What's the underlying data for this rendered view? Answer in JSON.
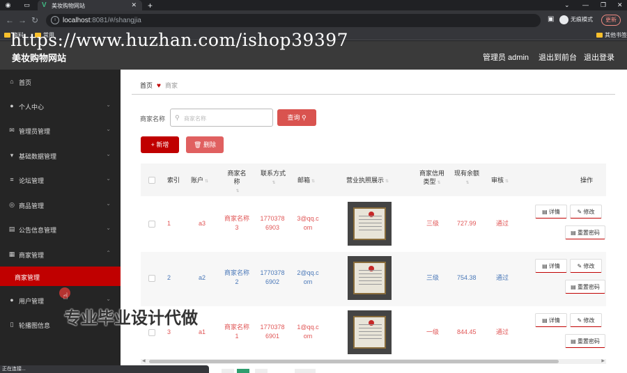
{
  "browser": {
    "tab_title": "美妆购物网站",
    "url_host": "localhost",
    "url_rest": ":8081/#/shangjia",
    "profile_label": "无痕模式",
    "update_label": "更新",
    "bookmarks": [
      "资料",
      "常用"
    ],
    "bookmarks_right": "其他书签"
  },
  "watermark": "https://www.huzhan.com/ishop39397",
  "watermark2": "专业毕业设计代做",
  "header": {
    "title": "美妆购物网站",
    "admin": "管理员 admin",
    "front": "退出到前台",
    "logout": "退出登录"
  },
  "sidebar": {
    "items": [
      {
        "label": "首页",
        "icon": "home-icon"
      },
      {
        "label": "个人中心",
        "icon": "user-icon"
      },
      {
        "label": "管理员管理",
        "icon": "mail-icon"
      },
      {
        "label": "基础数据管理",
        "icon": "pin-icon"
      },
      {
        "label": "论坛管理",
        "icon": "list-icon"
      },
      {
        "label": "商品管理",
        "icon": "globe-icon"
      },
      {
        "label": "公告信息管理",
        "icon": "doc-icon"
      },
      {
        "label": "商家管理",
        "icon": "grid-icon"
      },
      {
        "label": "用户管理",
        "icon": "user-icon"
      },
      {
        "label": "轮播图信息",
        "icon": "mobile-icon"
      }
    ],
    "active_sub": "商家管理"
  },
  "breadcrumb": {
    "home": "首页",
    "current": "商家"
  },
  "search": {
    "label": "商家名称",
    "placeholder": "商家名称",
    "button": "查询"
  },
  "actions": {
    "add": "新增",
    "delete": "删除"
  },
  "table": {
    "headers": {
      "index": "索引",
      "account": "账户",
      "name": "商家名称",
      "phone": "联系方式",
      "email": "邮箱",
      "license": "营业执照展示",
      "credit_1": "商家信用",
      "credit_2": "类型",
      "balance": "现有余额",
      "audit": "审核",
      "ops": "操作"
    },
    "rows": [
      {
        "index": "1",
        "account": "a3",
        "name_1": "商家名称",
        "name_2": "3",
        "phone_1": "1770378",
        "phone_2": "6903",
        "email_1": "3@qq.c",
        "email_2": "om",
        "credit": "三级",
        "balance": "727.99",
        "audit": "通过",
        "color": "#e05555"
      },
      {
        "index": "2",
        "account": "a2",
        "name_1": "商家名称",
        "name_2": "2",
        "phone_1": "1770378",
        "phone_2": "6902",
        "email_1": "2@qq.c",
        "email_2": "om",
        "credit": "三级",
        "balance": "754.38",
        "audit": "通过",
        "color": "#4a78b8"
      },
      {
        "index": "3",
        "account": "a1",
        "name_1": "商家名称",
        "name_2": "1",
        "phone_1": "1770378",
        "phone_2": "6901",
        "email_1": "1@qq.c",
        "email_2": "om",
        "credit": "一级",
        "balance": "844.45",
        "audit": "通过",
        "color": "#e05555"
      }
    ],
    "op_labels": {
      "detail": "详情",
      "edit": "修改",
      "reset": "重置密码"
    }
  },
  "status_bar": "正在连接..."
}
